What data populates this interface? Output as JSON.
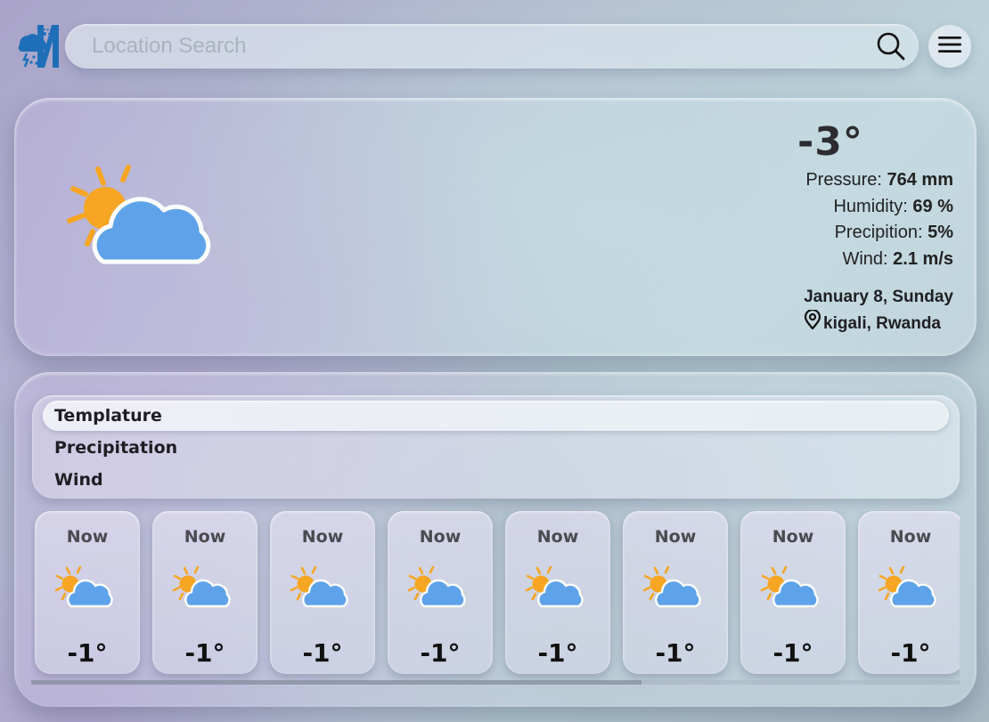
{
  "colors": {
    "logo_blue": "#1f6fb8",
    "sun": "#f6a623",
    "cloud": "#5ea3ea"
  },
  "search": {
    "placeholder": "Location Search",
    "icon": "search-icon"
  },
  "menu": {
    "icon": "hamburger-icon"
  },
  "current": {
    "icon": "partly-cloudy-icon",
    "temperature": "-3°",
    "pressure_label": "Pressure:",
    "pressure_value": "764 mm",
    "humidity_label": "Humidity:",
    "humidity_value": "69 %",
    "precipitation_label": "Precipition:",
    "precipitation_value": "5%",
    "wind_label": "Wind:",
    "wind_value": "2.1 m/s",
    "date": "January 8, Sunday",
    "location": "kigali, Rwanda",
    "location_icon": "map-pin-icon"
  },
  "tabs": [
    {
      "label": "Templature",
      "active": true
    },
    {
      "label": "Precipitation",
      "active": false
    },
    {
      "label": "Wind",
      "active": false
    }
  ],
  "hours": [
    {
      "label": "Now",
      "temp": "-1°",
      "icon": "partly-cloudy-icon"
    },
    {
      "label": "Now",
      "temp": "-1°",
      "icon": "partly-cloudy-icon"
    },
    {
      "label": "Now",
      "temp": "-1°",
      "icon": "partly-cloudy-icon"
    },
    {
      "label": "Now",
      "temp": "-1°",
      "icon": "partly-cloudy-icon"
    },
    {
      "label": "Now",
      "temp": "-1°",
      "icon": "partly-cloudy-icon"
    },
    {
      "label": "Now",
      "temp": "-1°",
      "icon": "partly-cloudy-icon"
    },
    {
      "label": "Now",
      "temp": "-1°",
      "icon": "partly-cloudy-icon"
    },
    {
      "label": "Now",
      "temp": "-1°",
      "icon": "partly-cloudy-icon"
    }
  ],
  "scroll_position": 0
}
